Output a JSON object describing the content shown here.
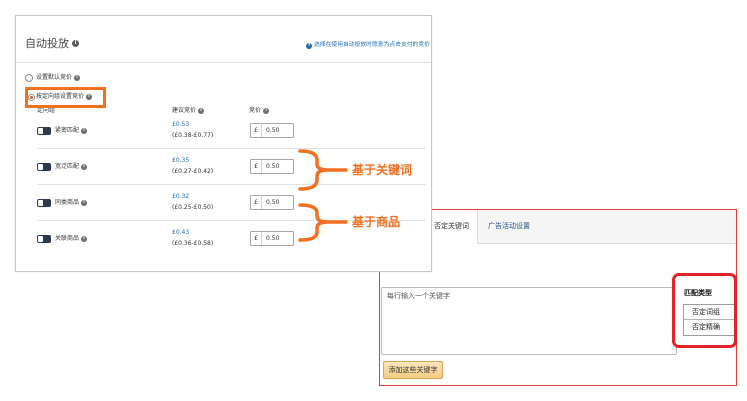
{
  "auto_targeting": {
    "title": "自动投放",
    "help_text": "选择在使用自动投放时愿意为点击支付的竞价",
    "options": [
      {
        "label": "设置默认竞价",
        "selected": false
      },
      {
        "label": "按定向组设置竞价",
        "selected": true
      }
    ],
    "columns": {
      "group": "定向组",
      "suggested_bid": "建议竞价",
      "bid": "竞价"
    },
    "currency": "£",
    "rows": [
      {
        "name": "紧密匹配",
        "enabled": true,
        "suggested_bid": "£0.53",
        "suggested_range": "(£0.38-£0.77)",
        "bid": "0.50"
      },
      {
        "name": "宽泛匹配",
        "enabled": true,
        "suggested_bid": "£0.35",
        "suggested_range": "(£0.27-£0.42)",
        "bid": "0.50"
      },
      {
        "name": "同类商品",
        "enabled": true,
        "suggested_bid": "£0.32",
        "suggested_range": "(£0.25-£0.50)",
        "bid": "0.50"
      },
      {
        "name": "关联商品",
        "enabled": true,
        "suggested_bid": "£0.43",
        "suggested_range": "(£0.36-£0.58)",
        "bid": "0.50"
      }
    ]
  },
  "annotations": {
    "keyword_groups_label": "基于关键词",
    "product_groups_label": "基于商品"
  },
  "negative_targeting": {
    "tabs": [
      {
        "label": "否定关键词",
        "active": true
      },
      {
        "label": "广告活动设置",
        "active": false
      }
    ],
    "keyword_input_placeholder": "每行输入一个关键字",
    "add_button_label": "添加这些关键字",
    "match_type_label": "匹配类型",
    "match_types": [
      "否定词组",
      "否定精确"
    ]
  },
  "colors": {
    "highlight_orange": "#f37021",
    "highlight_red": "#e32424",
    "link_blue": "#1f6db5",
    "toggle_navy": "#2b3a4e",
    "button_fill": "#f3cc82"
  },
  "icons": {
    "title_info": "info-icon",
    "help": "help-icon",
    "row_info": "info-icon",
    "targeting_toggle": "toggle-switch"
  }
}
